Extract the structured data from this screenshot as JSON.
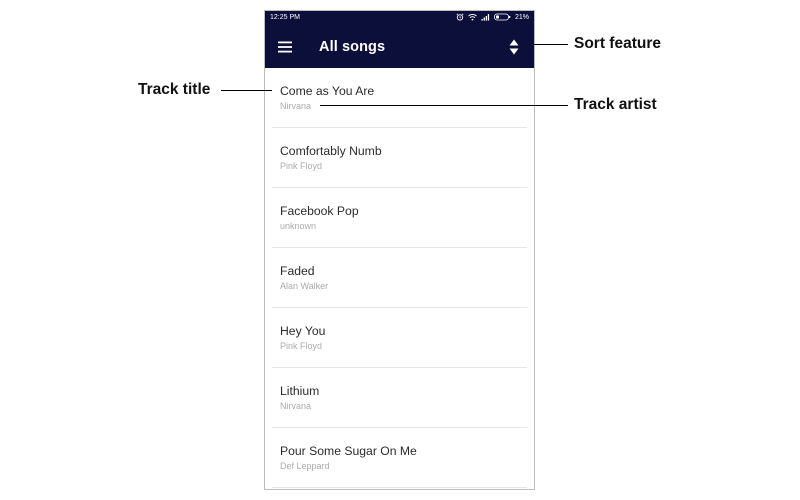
{
  "status_bar": {
    "time": "12:25 PM",
    "battery": "21%"
  },
  "app_bar": {
    "title": "All songs"
  },
  "icons": {
    "menu": "hamburger-menu-icon",
    "sort": "sort-up-down-icon"
  },
  "songs": [
    {
      "title": "Come as You Are",
      "artist": "Nirvana"
    },
    {
      "title": "Comfortably Numb",
      "artist": "Pink Floyd"
    },
    {
      "title": "Facebook Pop",
      "artist": "unknown"
    },
    {
      "title": "Faded",
      "artist": "Alan Walker"
    },
    {
      "title": "Hey You",
      "artist": "Pink Floyd"
    },
    {
      "title": "Lithium",
      "artist": "Nirvana"
    },
    {
      "title": "Pour Some Sugar On Me",
      "artist": "Def Leppard"
    }
  ],
  "annotations": {
    "track_title": "Track title",
    "track_artist": "Track artist",
    "sort_feature": "Sort feature"
  },
  "colors": {
    "app_bar": "#0d0f3b",
    "title_text": "#2b2b2b",
    "artist_text": "#ababab",
    "divider": "#e6e6e6"
  }
}
